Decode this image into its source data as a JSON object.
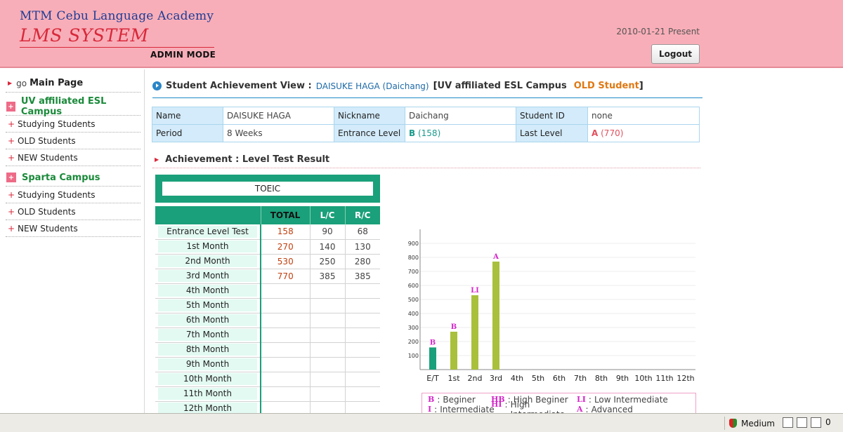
{
  "header": {
    "brand_line1": "MTM Cebu Language Academy",
    "brand_line2": "LMS SYSTEM",
    "mode": "ADMIN MODE",
    "date": "2010-01-21 Present",
    "logout_label": "Logout"
  },
  "sidebar": {
    "go": "go",
    "main_page": "Main Page",
    "campus1": "UV affiliated ESL Campus",
    "campus1_items": [
      "Studying Students",
      "OLD Students",
      "NEW Students"
    ],
    "campus2": "Sparta Campus",
    "campus2_items": [
      "Studying Students",
      "OLD Students",
      "NEW Students"
    ]
  },
  "view": {
    "title_label": "Student Achievement View :",
    "student": "DAISUKE HAGA (Daichang)",
    "bracket_open": "[",
    "campus": "UV affiliated ESL Campus",
    "status": "OLD Student",
    "bracket_close": "]"
  },
  "info": {
    "name_label": "Name",
    "name": "DAISUKE HAGA",
    "nickname_label": "Nickname",
    "nickname": "Daichang",
    "id_label": "Student ID",
    "id": "none",
    "period_label": "Period",
    "period": "8 Weeks",
    "entrance_label": "Entrance Level",
    "entrance_grade": "B",
    "entrance_score": "(158)",
    "last_label": "Last Level",
    "last_grade": "A",
    "last_score": "(770)"
  },
  "achievement": {
    "title": "Achievement : Level Test Result",
    "test_name": "TOEIC",
    "col_total": "TOTAL",
    "col_lc": "L/C",
    "col_rc": "R/C",
    "rows": [
      {
        "label": "Entrance Level Test",
        "total": "158",
        "lc": "90",
        "rc": "68"
      },
      {
        "label": "1st Month",
        "total": "270",
        "lc": "140",
        "rc": "130"
      },
      {
        "label": "2nd Month",
        "total": "530",
        "lc": "250",
        "rc": "280"
      },
      {
        "label": "3rd Month",
        "total": "770",
        "lc": "385",
        "rc": "385"
      },
      {
        "label": "4th Month",
        "total": "",
        "lc": "",
        "rc": ""
      },
      {
        "label": "5th Month",
        "total": "",
        "lc": "",
        "rc": ""
      },
      {
        "label": "6th Month",
        "total": "",
        "lc": "",
        "rc": ""
      },
      {
        "label": "7th Month",
        "total": "",
        "lc": "",
        "rc": ""
      },
      {
        "label": "8th Month",
        "total": "",
        "lc": "",
        "rc": ""
      },
      {
        "label": "9th Month",
        "total": "",
        "lc": "",
        "rc": ""
      },
      {
        "label": "10th Month",
        "total": "",
        "lc": "",
        "rc": ""
      },
      {
        "label": "11th Month",
        "total": "",
        "lc": "",
        "rc": ""
      },
      {
        "label": "12th Month",
        "total": "",
        "lc": "",
        "rc": ""
      }
    ]
  },
  "chart_data": {
    "type": "bar",
    "categories": [
      "E/T",
      "1st",
      "2nd",
      "3rd",
      "4th",
      "5th",
      "6th",
      "7th",
      "8th",
      "9th",
      "10th",
      "11th",
      "12th"
    ],
    "values": [
      158,
      270,
      530,
      770,
      null,
      null,
      null,
      null,
      null,
      null,
      null,
      null,
      null
    ],
    "bar_labels": [
      "B",
      "B",
      "LI",
      "A",
      "",
      "",
      "",
      "",
      "",
      "",
      "",
      "",
      ""
    ],
    "bar_colors": [
      "#1aa07a",
      "#a8c03c",
      "#a8c03c",
      "#a8c03c"
    ],
    "yticks": [
      100,
      200,
      300,
      400,
      500,
      600,
      700,
      800,
      900
    ],
    "ylim": [
      0,
      1000
    ],
    "grid": true,
    "title": "",
    "xlabel": "",
    "ylabel": ""
  },
  "legend": {
    "row1": [
      {
        "key": "B",
        "text": "Beginer"
      },
      {
        "key": "HB",
        "text": "High Beginer"
      },
      {
        "key": "LI",
        "text": "Low Intermediate"
      }
    ],
    "row2": [
      {
        "key": "I",
        "text": "Intermediate"
      },
      {
        "key": "HI",
        "text": "High Intermediate"
      },
      {
        "key": "A",
        "text": "Advanced"
      }
    ],
    "separator": ":"
  },
  "statusbar": {
    "security": "Medium",
    "zoom": "0"
  }
}
